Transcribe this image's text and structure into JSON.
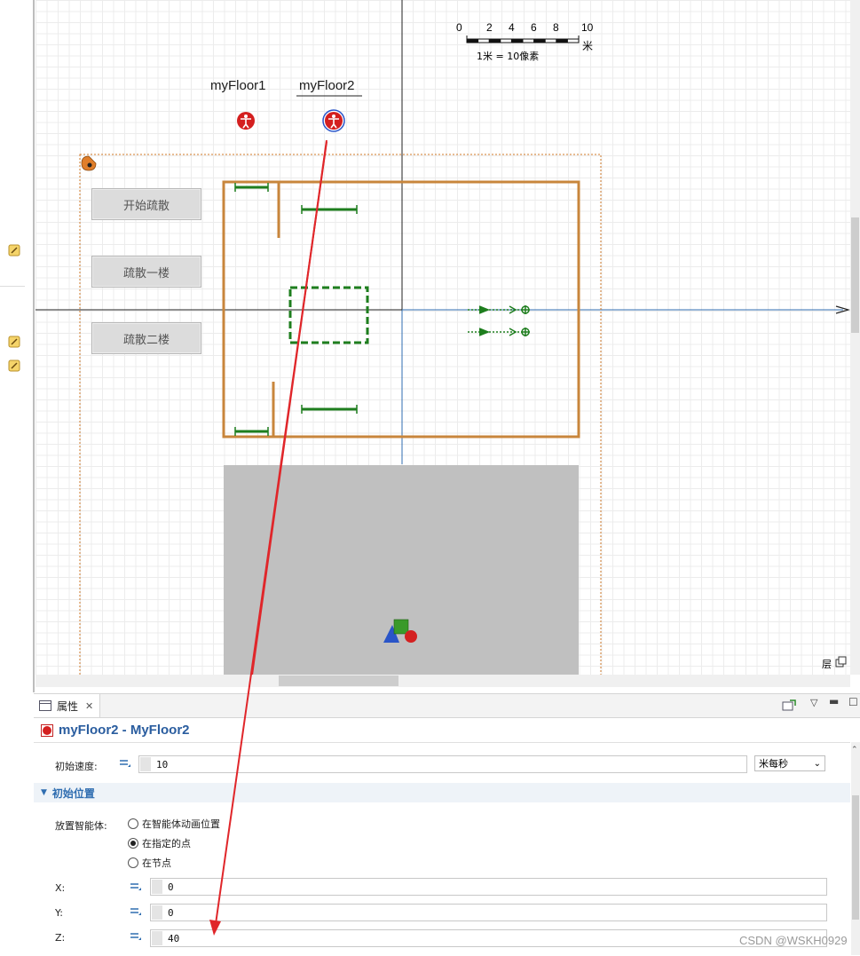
{
  "canvas": {
    "floor_labels": [
      "myFloor1",
      "myFloor2"
    ],
    "buttons": [
      "开始疏散",
      "疏散一楼",
      "疏散二楼"
    ],
    "scale": {
      "ticks": [
        "0",
        "2",
        "4",
        "6",
        "8",
        "10"
      ],
      "unit": "米",
      "ratio_text": "1米 = 10像素"
    },
    "corner_icons": [
      "layers-icon",
      "copy-icon"
    ],
    "corner_text": "层"
  },
  "panel": {
    "tab_label": "属性",
    "title": "myFloor2 - MyFloor2",
    "speed": {
      "label": "初始速度:",
      "value": "10",
      "unit": "米每秒"
    },
    "section_title": "初始位置",
    "place_label": "放置智能体:",
    "place_options": [
      {
        "label": "在智能体动画位置",
        "selected": false
      },
      {
        "label": "在指定的点",
        "selected": true
      },
      {
        "label": "在节点",
        "selected": false
      }
    ],
    "x": {
      "label": "X:",
      "value": "0"
    },
    "y": {
      "label": "Y:",
      "value": "0"
    },
    "z": {
      "label": "Z:",
      "value": "40"
    }
  },
  "watermark": "CSDN @WSKH0929",
  "colors": {
    "arrow": "#e0262a",
    "wall": "#c8863c",
    "path": "#1e7e1e",
    "axis_blue": "#2f6db0",
    "title_blue": "#2a5d9f"
  }
}
